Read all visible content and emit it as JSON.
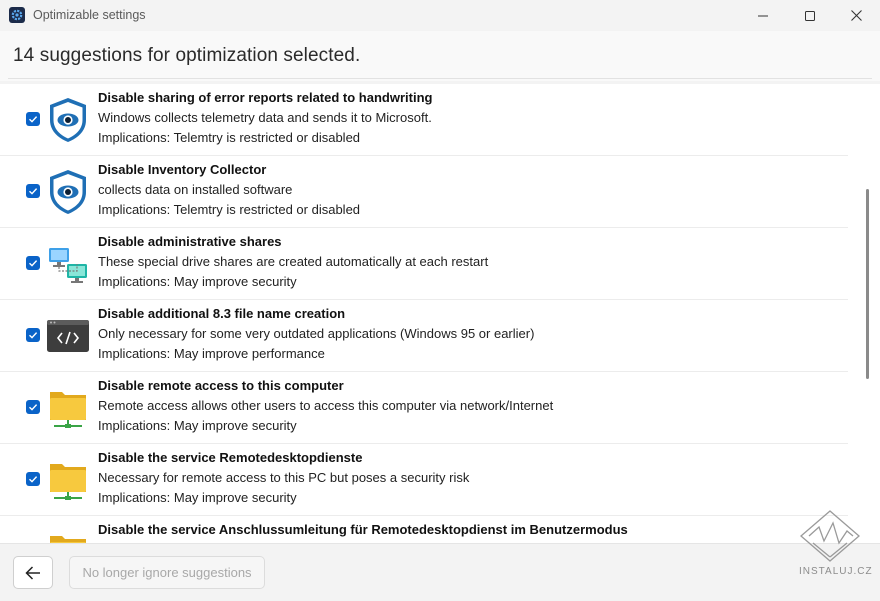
{
  "window": {
    "title": "Optimizable settings",
    "icon": "gear-app-icon",
    "controls": [
      "minimize-icon",
      "maximize-icon",
      "close-icon"
    ]
  },
  "header": {
    "title": "14 suggestions for optimization selected."
  },
  "items": [
    {
      "title": "Disable sharing of error reports related to handwriting",
      "description": "Windows collects telemetry data and sends it to Microsoft.",
      "implications": "Implications: Telemtry is restricted or disabled",
      "icon": "shield-eye-icon",
      "checked": true
    },
    {
      "title": "Disable Inventory Collector",
      "description": "collects data on installed software",
      "implications": "Implications: Telemtry is restricted or disabled",
      "icon": "shield-eye-icon",
      "checked": true
    },
    {
      "title": "Disable administrative shares",
      "description": "These special drive shares are created automatically at each restart",
      "implications": "Implications: May improve security",
      "icon": "network-computers-icon",
      "checked": true
    },
    {
      "title": "Disable additional 8.3 file name creation",
      "description": "Only necessary for some very outdated applications (Windows 95 or earlier)",
      "implications": "Implications: May improve performance",
      "icon": "code-window-icon",
      "checked": true
    },
    {
      "title": "Disable remote access to this computer",
      "description": "Remote access allows other users to access this computer via network/Internet",
      "implications": "Implications: May improve security",
      "icon": "network-folder-icon",
      "checked": true
    },
    {
      "title": "Disable the service Remotedesktopdienste",
      "description": "Necessary for remote access to this PC but poses a security risk",
      "implications": "Implications: May improve security",
      "icon": "network-folder-icon",
      "checked": true
    },
    {
      "title": "Disable the service Anschlussumleitung für Remotedesktopdienst im Benutzermodus",
      "description": "",
      "implications": "",
      "icon": "network-folder-icon",
      "checked": true
    }
  ],
  "footer": {
    "back_icon": "arrow-left-icon",
    "ignore_label": "No longer ignore suggestions"
  },
  "watermark": {
    "text": "INSTALUJ.CZ"
  },
  "colors": {
    "accent": "#0a63c8",
    "shield": "#1f6fb5",
    "folder": "#f5c231"
  }
}
